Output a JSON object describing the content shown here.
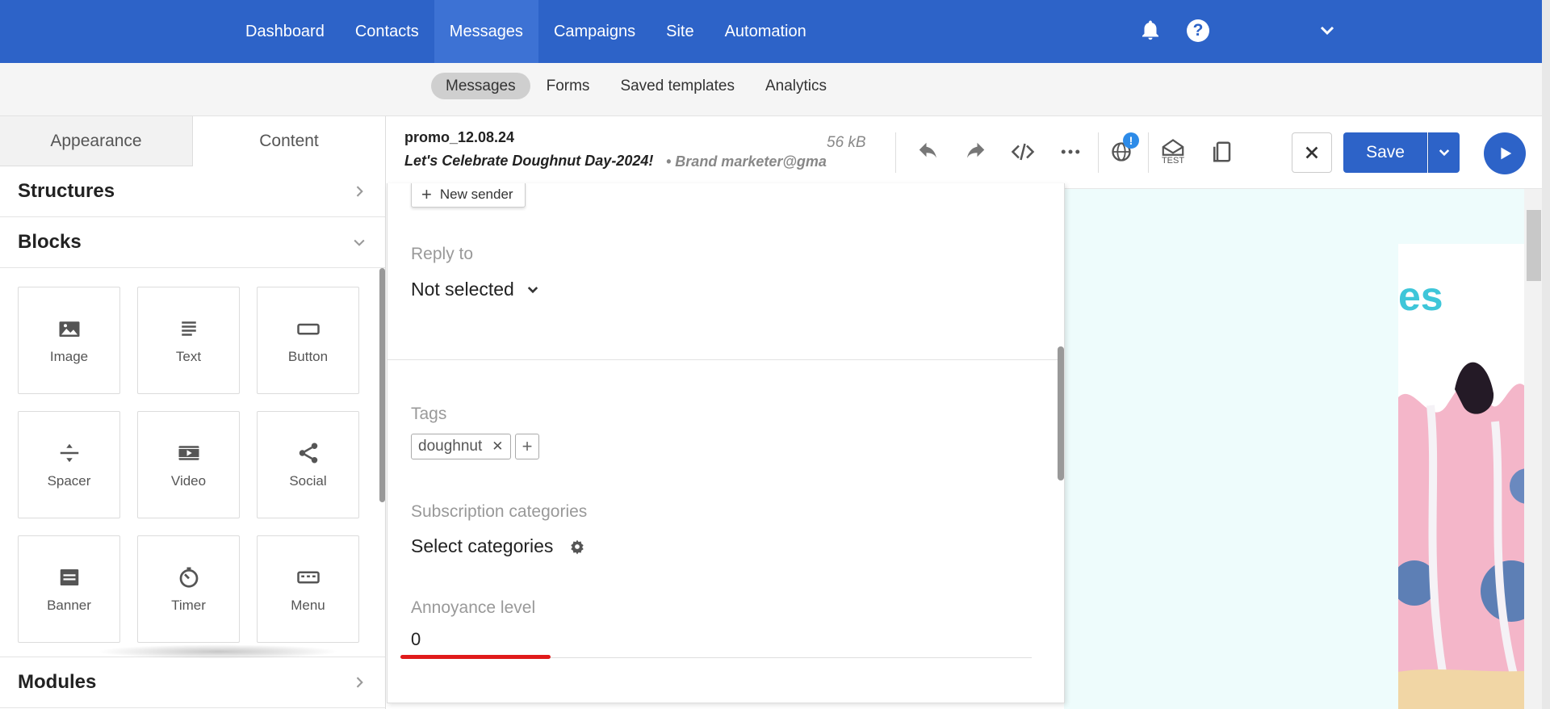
{
  "topnav": {
    "items": [
      "Dashboard",
      "Contacts",
      "Messages",
      "Campaigns",
      "Site",
      "Automation"
    ],
    "active": "Messages"
  },
  "subnav": {
    "items": [
      "Messages",
      "Forms",
      "Saved templates",
      "Analytics"
    ],
    "active": "Messages"
  },
  "left_panel": {
    "tabs": [
      "Appearance",
      "Content"
    ],
    "active_tab": "Content",
    "structures_label": "Structures",
    "blocks_label": "Blocks",
    "modules_label": "Modules",
    "blocks": [
      "Image",
      "Text",
      "Button",
      "Spacer",
      "Video",
      "Social",
      "Banner",
      "Timer",
      "Menu"
    ]
  },
  "toolbar": {
    "doc_name": "promo_12.08.24",
    "subject": "Let's Celebrate Doughnut Day-2024!",
    "sender": "• Brand marketer@gma",
    "size": "56 kB",
    "test_label": "TEST",
    "badge": "!",
    "save_label": "Save"
  },
  "settings_panel": {
    "new_sender_label": "New sender",
    "reply_to_label": "Reply to",
    "reply_to_value": "Not selected",
    "tags_label": "Tags",
    "tags": [
      "doughnut"
    ],
    "subscription_label": "Subscription categories",
    "subscription_value": "Select categories",
    "annoyance_label": "Annoyance level",
    "annoyance_value": "0"
  },
  "colors": {
    "brand": "#2d63c8",
    "preview_bg": "#eefcfc",
    "annoyance_indicator": "#e01a1a"
  }
}
